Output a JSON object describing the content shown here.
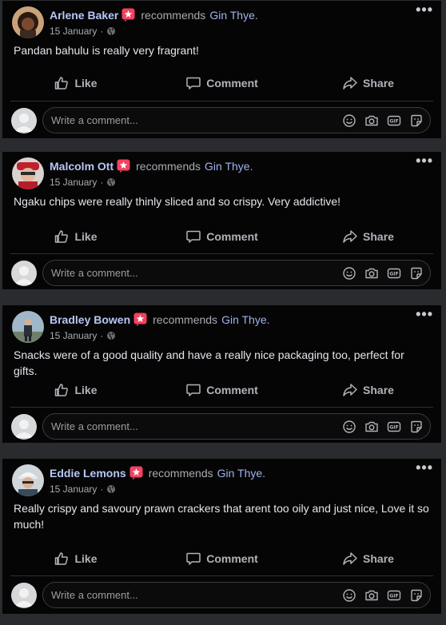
{
  "posts": [
    {
      "author": "Arlene Baker",
      "verb": "recommends",
      "page": "Gin Thye.",
      "date": "15 January",
      "separator": "·",
      "text": "Pandan bahulu is really very fragrant!"
    },
    {
      "author": "Malcolm Ott",
      "verb": "recommends",
      "page": "Gin Thye.",
      "date": "15 January",
      "separator": "·",
      "text": "Ngaku chips were really thinly sliced and so crispy. Very addictive!"
    },
    {
      "author": "Bradley Bowen",
      "verb": "recommends",
      "page": "Gin Thye.",
      "date": "15 January",
      "separator": "·",
      "text": "Snacks were of a good quality and have a really nice packaging too, perfect for gifts."
    },
    {
      "author": "Eddie Lemons",
      "verb": "recommends",
      "page": "Gin Thye.",
      "date": "15 January",
      "separator": "·",
      "text": "Really crispy and savoury prawn crackers that arent too oily and just nice, Love it so much!"
    }
  ],
  "actions": {
    "like": "Like",
    "comment": "Comment",
    "share": "Share"
  },
  "comment_box": {
    "placeholder": "Write a comment..."
  },
  "menu_glyph": "•••",
  "icons": [
    "recommend-badge-icon",
    "globe-icon",
    "like-icon",
    "comment-icon",
    "share-icon",
    "emoji-icon",
    "camera-icon",
    "gif-icon",
    "sticker-icon",
    "more-icon"
  ],
  "colors": {
    "background": "#2a2b2e",
    "card": "#050506",
    "author": "#b7c7f5",
    "badge": "#f3425f"
  }
}
